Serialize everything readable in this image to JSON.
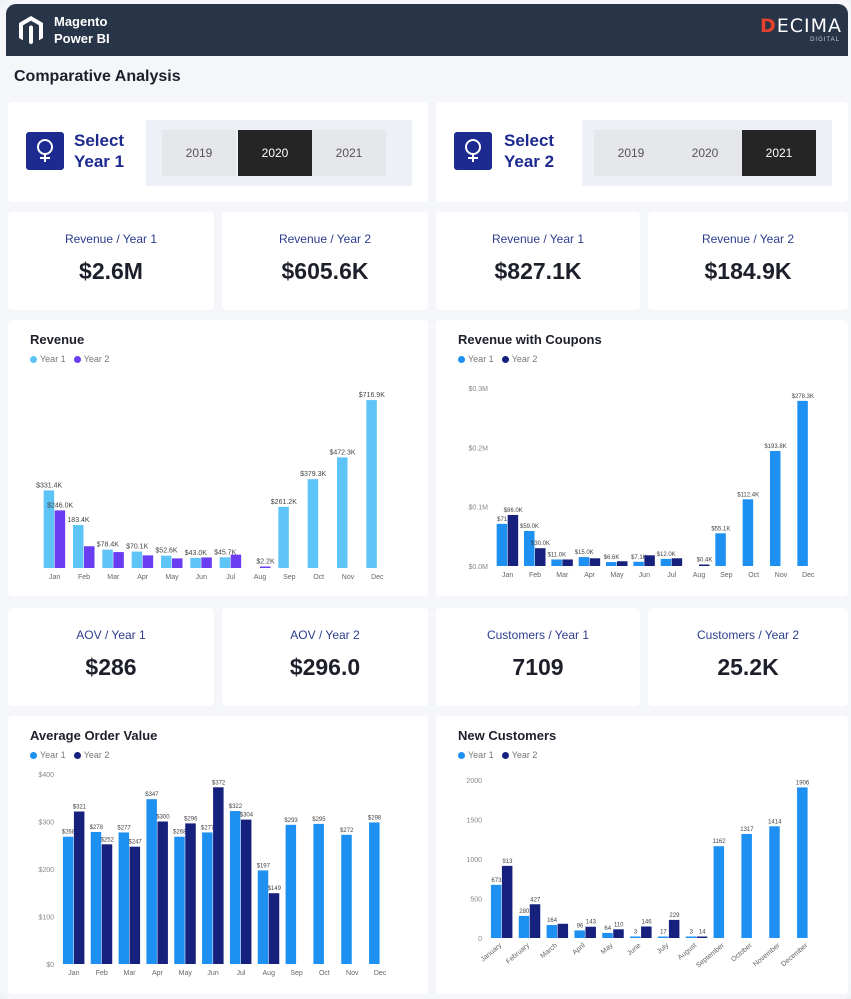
{
  "app": {
    "name_line1": "Magento",
    "name_line2": "Power BI",
    "brand": "ECIMA",
    "brand_initial": "D",
    "brand_sub": "DIGITAL"
  },
  "page_title": "Comparative Analysis",
  "selectors": [
    {
      "label_line1": "Select",
      "label_line2": "Year 1",
      "options": [
        "2019",
        "2020",
        "2021"
      ],
      "selected": "2020"
    },
    {
      "label_line1": "Select",
      "label_line2": "Year 2",
      "options": [
        "2019",
        "2020",
        "2021"
      ],
      "selected": "2021"
    }
  ],
  "kpis_row1": [
    {
      "label": "Revenue / Year 1",
      "value": "$2.6M"
    },
    {
      "label": "Revenue / Year 2",
      "value": "$605.6K"
    },
    {
      "label": "Revenue / Year 1",
      "value": "$827.1K"
    },
    {
      "label": "Revenue / Year 2",
      "value": "$184.9K"
    }
  ],
  "kpis_row2": [
    {
      "label": "AOV / Year 1",
      "value": "$286"
    },
    {
      "label": "AOV / Year 2",
      "value": "$296.0"
    },
    {
      "label": "Customers / Year 1",
      "value": "7109"
    },
    {
      "label": "Customers / Year 2",
      "value": "25.2K"
    }
  ],
  "colors": {
    "topbar": "#283447",
    "accent": "#1d2a8f",
    "brand_red": "#e5412e"
  },
  "chart_data": [
    {
      "id": "revenue",
      "type": "bar",
      "title": "Revenue",
      "legend": [
        "Year 1",
        "Year 2"
      ],
      "colors": [
        "#5ec3f7",
        "#6a3df2"
      ],
      "categories": [
        "Jan",
        "Feb",
        "Mar",
        "Apr",
        "May",
        "Jun",
        "Jul",
        "Aug",
        "Sep",
        "Oct",
        "Nov",
        "Dec"
      ],
      "series": [
        {
          "name": "Year 1",
          "values": [
            331.4,
            183.4,
            78.4,
            70.1,
            52.6,
            43.0,
            45.7,
            0,
            261.2,
            379.3,
            472.3,
            716.9
          ]
        },
        {
          "name": "Year 2",
          "values": [
            246.0,
            93.0,
            68.0,
            54.0,
            41.0,
            45.0,
            57.0,
            2.2,
            null,
            null,
            null,
            null
          ]
        }
      ],
      "data_labels": [
        [
          "$331.4K",
          "183.4K",
          "$78.4K",
          "$70.1K",
          "$52.6K",
          "$43.0K",
          "$45.7K",
          "",
          "$261.2K",
          "$379.3K",
          "$472.3K",
          "$716.9K"
        ],
        [
          "$246.0K",
          "",
          "",
          "",
          "",
          "",
          "",
          "$2.2K",
          "",
          "",
          "",
          ""
        ]
      ],
      "ylim": [
        0,
        760
      ],
      "grid": false
    },
    {
      "id": "revenue-coupons",
      "type": "bar",
      "title": "Revenue with Coupons",
      "legend": [
        "Year 1",
        "Year 2"
      ],
      "colors": [
        "#1e90f2",
        "#16207d"
      ],
      "categories": [
        "Jan",
        "Feb",
        "Mar",
        "Apr",
        "May",
        "Jun",
        "Jul",
        "Aug",
        "Sep",
        "Oct",
        "Nov",
        "Dec"
      ],
      "series": [
        {
          "name": "Year 1",
          "values": [
            71,
            59,
            11,
            15,
            6.6,
            7.1,
            12,
            0,
            55.1,
            112.4,
            193.8,
            278.3
          ]
        },
        {
          "name": "Year 2",
          "values": [
            86,
            30,
            11,
            13,
            8,
            18,
            13,
            0.4,
            null,
            null,
            null,
            null
          ]
        }
      ],
      "data_labels": [
        [
          "$71",
          "$59.0K",
          "$11.0K",
          "$15.0K",
          "$6.6K",
          "$7.1K",
          "$12.0K",
          "",
          "$55.1K",
          "$112.4K",
          "$193.8K",
          "$278.3K"
        ],
        [
          "$86.0K",
          "$30.0K",
          "",
          "",
          "",
          "",
          "",
          "$0.4K",
          "",
          "",
          "",
          ""
        ]
      ],
      "yticks": [
        "$0.0M",
        "$0.1M",
        "$0.2M",
        "$0.3M"
      ],
      "ylim": [
        0,
        300
      ],
      "grid": false
    },
    {
      "id": "aov",
      "type": "bar",
      "title": "Average Order Value",
      "legend": [
        "Year 1",
        "Year 2"
      ],
      "colors": [
        "#1e90f2",
        "#16207d"
      ],
      "categories": [
        "Jan",
        "Feb",
        "Mar",
        "Apr",
        "May",
        "Jun",
        "Jul",
        "Aug",
        "Sep",
        "Oct",
        "Nov",
        "Dec"
      ],
      "series": [
        {
          "name": "Year 1",
          "values": [
            268,
            278,
            277,
            347,
            268,
            277,
            322,
            197,
            293,
            295,
            272,
            298
          ]
        },
        {
          "name": "Year 2",
          "values": [
            321,
            252,
            247,
            300,
            296,
            372,
            304,
            149,
            null,
            null,
            null,
            null
          ]
        }
      ],
      "data_labels": [
        [
          "$268",
          "$278",
          "$277",
          "$347",
          "$268",
          "$277",
          "$322",
          "$197",
          "$293",
          "$295",
          "$272",
          "$298"
        ],
        [
          "$321",
          "$252",
          "$247",
          "$300",
          "$296",
          "$372",
          "$304",
          "$149",
          "",
          "",
          "",
          ""
        ]
      ],
      "yticks": [
        "$0",
        "$100",
        "$200",
        "$300",
        "$400"
      ],
      "ylim": [
        0,
        400
      ],
      "grid": false
    },
    {
      "id": "new-customers",
      "type": "bar",
      "title": "New Customers",
      "legend": [
        "Year 1",
        "Year 2"
      ],
      "colors": [
        "#1e90f2",
        "#16207d"
      ],
      "categories": [
        "January",
        "February",
        "March",
        "April",
        "May",
        "June",
        "July",
        "August",
        "September",
        "October",
        "November",
        "December"
      ],
      "series": [
        {
          "name": "Year 1",
          "values": [
            673,
            280,
            164,
            96,
            64,
            3,
            17,
            3,
            1162,
            1317,
            1414,
            1906
          ]
        },
        {
          "name": "Year 2",
          "values": [
            913,
            427,
            180,
            143,
            110,
            146,
            229,
            14,
            null,
            null,
            null,
            null
          ]
        }
      ],
      "data_labels": [
        [
          "673",
          "280",
          "164",
          "96",
          "64",
          "3",
          "17",
          "3",
          "1162",
          "1317",
          "1414",
          "1906"
        ],
        [
          "913",
          "427",
          "",
          "143",
          "110",
          "146",
          "229",
          "14",
          "",
          "",
          "",
          ""
        ]
      ],
      "yticks": [
        "0",
        "500",
        "1000",
        "1500",
        "2000"
      ],
      "ylim": [
        0,
        2000
      ],
      "grid": false
    }
  ]
}
